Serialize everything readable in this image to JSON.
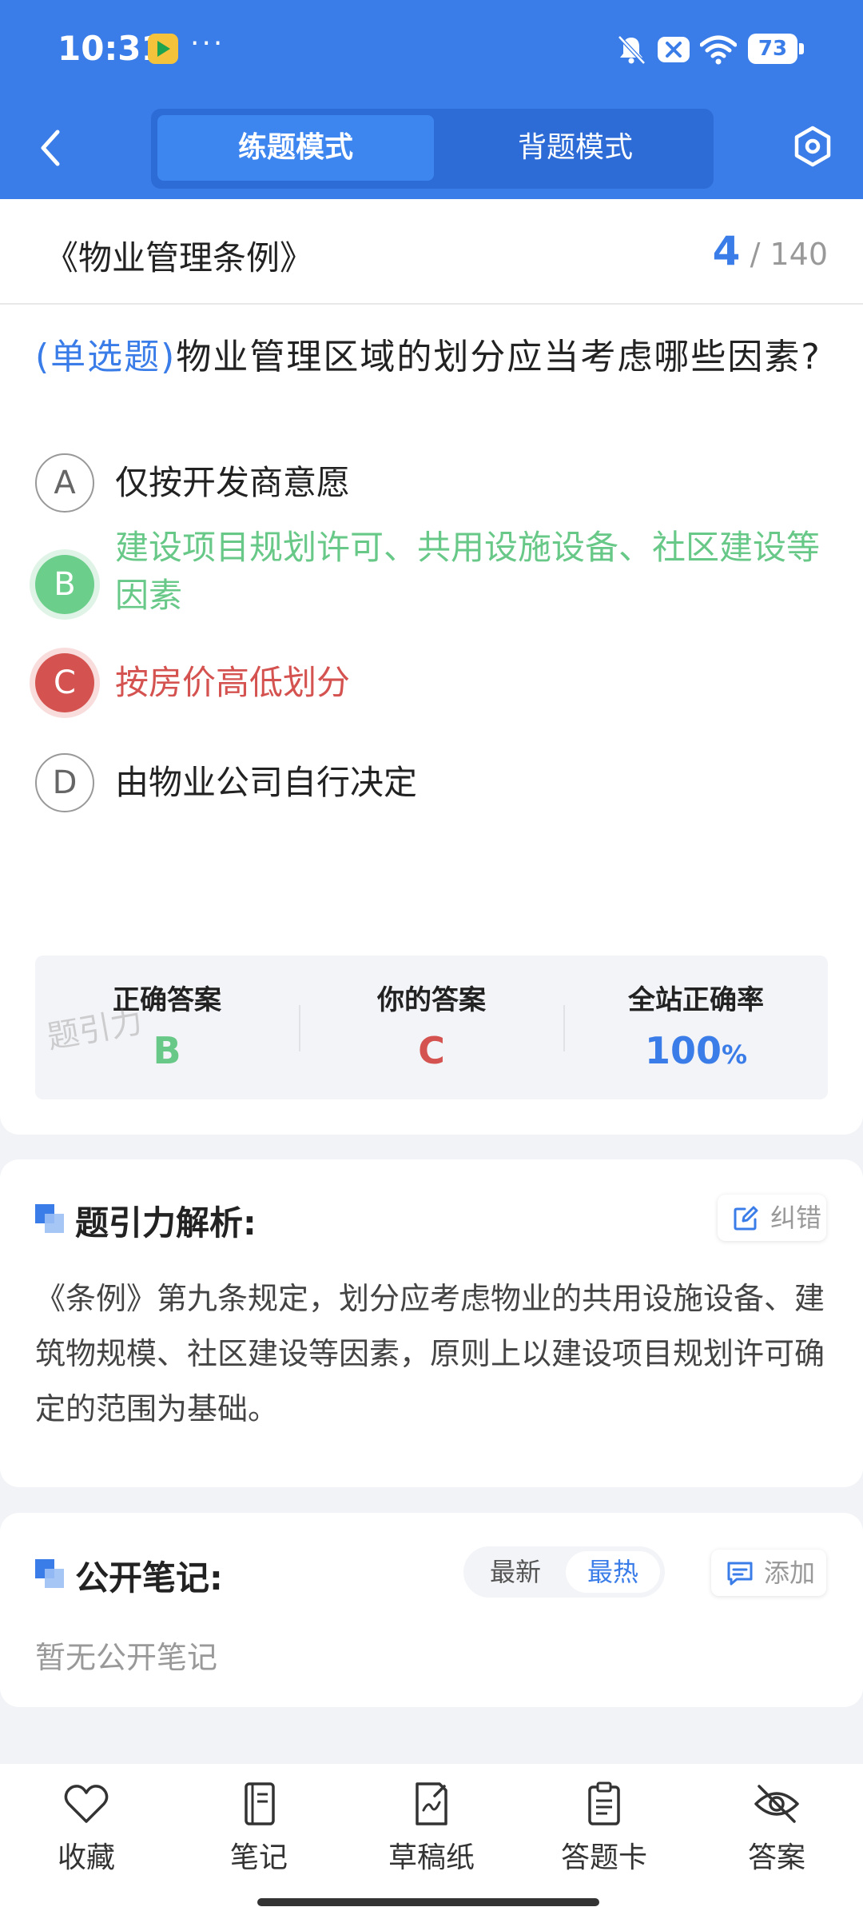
{
  "status_bar": {
    "time": "10:31",
    "dots": "···",
    "battery": "73",
    "icons": [
      "app-badge-icon",
      "bell-muted-icon",
      "close-box-icon",
      "wifi-icon",
      "battery-icon"
    ]
  },
  "header": {
    "modes": [
      "练题模式",
      "背题模式"
    ],
    "active_mode": "练题模式",
    "accent_color": "#3b7de8"
  },
  "question_card": {
    "chapter_title": "《物业管理条例》",
    "current_index": "4",
    "separator": "/",
    "total": "140",
    "question_type": "(单选题)",
    "question_text": "物业管理区域的划分应当考虑哪些因素?",
    "options": [
      {
        "letter": "A",
        "text": "仅按开发商意愿",
        "state": "default"
      },
      {
        "letter": "B",
        "text": "建设项目规划许可、共用设施设备、社区建设等因素",
        "state": "correct"
      },
      {
        "letter": "C",
        "text": "按房价高低划分",
        "state": "wrong"
      },
      {
        "letter": "D",
        "text": "由物业公司自行决定",
        "state": "default"
      }
    ],
    "stats": {
      "correct_label": "正确答案",
      "correct_value": "B",
      "yours_label": "你的答案",
      "yours_value": "C",
      "rate_label": "全站正确率",
      "rate_value": "100",
      "rate_unit": "%"
    },
    "watermark": "题引力",
    "colors": {
      "correct": "#67c887",
      "wrong": "#d4524f",
      "accent": "#3b7de8"
    }
  },
  "analysis": {
    "title": "题引力解析:",
    "correct_button": "纠错",
    "text": "《条例》第九条规定，划分应考虑物业的共用设施设备、建筑物规模、社区建设等因素，原则上以建设项目规划许可确定的范围为基础。"
  },
  "notes": {
    "title": "公开笔记:",
    "sort_options": [
      "最新",
      "最热"
    ],
    "active_sort": "最热",
    "add_button": "添加",
    "empty_text": "暂无公开笔记"
  },
  "bottom_bar": {
    "items": [
      {
        "label": "收藏",
        "icon": "heart-icon"
      },
      {
        "label": "笔记",
        "icon": "notebook-icon"
      },
      {
        "label": "草稿纸",
        "icon": "draft-icon"
      },
      {
        "label": "答题卡",
        "icon": "clipboard-icon"
      },
      {
        "label": "答案",
        "icon": "eye-off-icon"
      }
    ]
  }
}
